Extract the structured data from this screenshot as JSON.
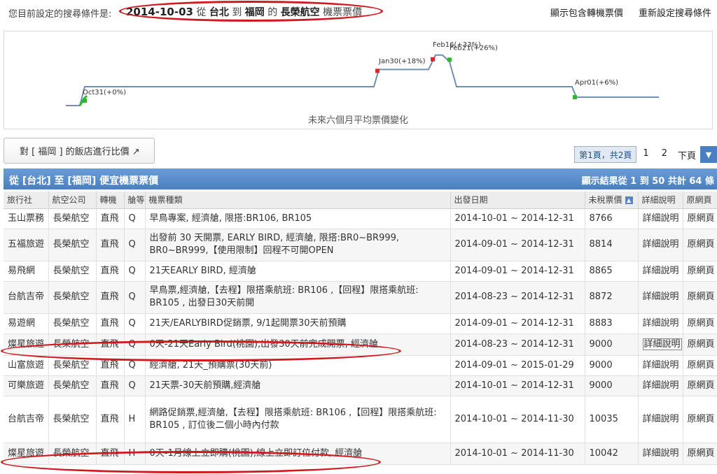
{
  "top": {
    "prefix": "您目前設定的搜尋條件是:",
    "date": "2014-10-03",
    "from_word": "從",
    "origin": "台北",
    "to_word": "到",
    "destination": "福岡",
    "of_word": "的",
    "airline": "長榮航空",
    "suffix": "機票票價",
    "link_transfer": "顯示包含轉機票價",
    "link_reset": "重新設定搜尋條件"
  },
  "chart_data": {
    "type": "line",
    "title": "未來六個月平均票價變化",
    "x": [
      "Oct31",
      "Jan30",
      "Feb16",
      "Feb21",
      "Apr01"
    ],
    "values_pct": [
      0,
      18,
      33,
      26,
      6
    ],
    "annotations": [
      "Oct31(+0%)",
      "Jan30(+18%)",
      "Feb16(+33%)",
      "Feb21(+26%)",
      "Apr01(+6%)"
    ],
    "colors": {
      "line": "#6f8fb5",
      "rise": "#d9262b",
      "fall": "#2db82d"
    }
  },
  "hotel_button": "對 [ 福岡 ] 的飯店進行比價 ↗",
  "pager": {
    "current": "第1頁，共2頁",
    "pages": [
      "1",
      "2"
    ],
    "next": "下頁"
  },
  "band": {
    "title": "從 [台北] 至 [福岡] 便宜機票票價",
    "count": "顯示結果從 1 到 50 共計 64 條"
  },
  "columns": [
    "旅行社",
    "航空公司",
    "轉機",
    "艙等",
    "機票種類",
    "出發日期",
    "未稅票價",
    "詳細說明",
    "原網頁"
  ],
  "rows": [
    {
      "agency": "玉山票務",
      "airline": "長榮航空",
      "transfer": "直飛",
      "cabin": "Q",
      "ticket": "早鳥專案, 經濟艙, 限搭:BR106, BR105",
      "dates": "2014-10-01 ~ 2014-12-31",
      "price": "8766",
      "detail": "詳細說明",
      "source": "原網頁"
    },
    {
      "agency": "五福旅遊",
      "airline": "長榮航空",
      "transfer": "直飛",
      "cabin": "Q",
      "ticket": "出發前 30 天開票, EARLY BIRD, 經濟艙, 限搭:BR0~BR999, BR0~BR999,【使用限制】回程不可開OPEN",
      "dates": "2014-09-01 ~ 2014-12-31",
      "price": "8814",
      "detail": "詳細說明",
      "source": "原網頁"
    },
    {
      "agency": "易飛網",
      "airline": "長榮航空",
      "transfer": "直飛",
      "cabin": "Q",
      "ticket": "21天EARLY BIRD, 經濟艙",
      "dates": "2014-09-01 ~ 2014-12-31",
      "price": "8865",
      "detail": "詳細說明",
      "source": "原網頁"
    },
    {
      "agency": "台航吉帝",
      "airline": "長榮航空",
      "transfer": "直飛",
      "cabin": "Q",
      "ticket": "早鳥票,經濟艙,【去程】限搭乘航班: BR106 ,【回程】限搭乘航班: BR105 , 出發日30天前開",
      "dates": "2014-08-23 ~ 2014-12-31",
      "price": "8872",
      "detail": "詳細說明",
      "source": "原網頁"
    },
    {
      "agency": "易遊網",
      "airline": "長榮航空",
      "transfer": "直飛",
      "cabin": "Q",
      "ticket": "21天/EARLYBIRD促銷票, 9/1起開票30天前預購",
      "dates": "2014-09-01 ~ 2014-12-31",
      "price": "8883",
      "detail": "詳細說明",
      "source": "原網頁"
    },
    {
      "agency": "燦星旅遊",
      "airline": "長榮航空",
      "transfer": "直飛",
      "cabin": "Q",
      "ticket": "0天-21天Early Bird(桃園),出發30天前完成開票, 經濟艙",
      "dates": "2014-08-23 ~ 2014-12-31",
      "price": "9000",
      "detail": "詳細說明",
      "source": "原網頁"
    },
    {
      "agency": "山富旅遊",
      "airline": "長榮航空",
      "transfer": "直飛",
      "cabin": "Q",
      "ticket": "經濟艙, 21天_預購票(30天前)",
      "dates": "2014-09-01 ~ 2015-01-29",
      "price": "9000",
      "detail": "詳細說明",
      "source": "原網頁"
    },
    {
      "agency": "可樂旅遊",
      "airline": "長榮航空",
      "transfer": "直飛",
      "cabin": "Q",
      "ticket": "21天票-30天前預購,經濟艙",
      "dates": "2014-10-01 ~ 2014-12-31",
      "price": "9000",
      "detail": "詳細說明",
      "source": "原網頁"
    },
    {
      "agency": "台航吉帝",
      "airline": "長榮航空",
      "transfer": "直飛",
      "cabin": "H",
      "ticket": "網路促銷票,經濟艙,【去程】限搭乘航班: BR106 ,【回程】限搭乘航班: BR105 , 訂位後二個小時內付款",
      "dates": "2014-10-01 ~ 2014-11-30",
      "price": "10035",
      "detail": "詳細說明",
      "source": "原網頁"
    },
    {
      "agency": "燦星旅遊",
      "airline": "長榮航空",
      "transfer": "直飛",
      "cabin": "H",
      "ticket": "0天-1月線上立即購(桃園),線上立即訂位付款, 經濟艙",
      "dates": "2014-10-01 ~ 2014-11-30",
      "price": "10042",
      "detail": "詳細說明",
      "source": "原網頁"
    }
  ]
}
